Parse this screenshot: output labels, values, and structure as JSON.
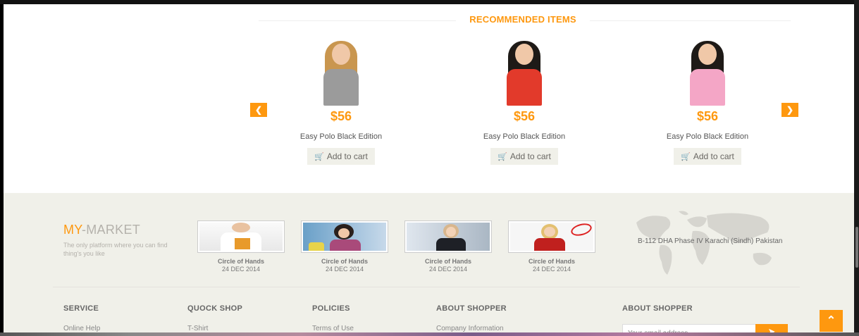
{
  "recommended": {
    "title": "RECOMMENDED ITEMS",
    "products": [
      {
        "price": "$56",
        "name": "Easy Polo Black Edition",
        "cart_label": "Add to cart",
        "cart_icon": "shopping-cart-icon",
        "hair_color": "#c9964f",
        "outfit_color": "#9b9b9b"
      },
      {
        "price": "$56",
        "name": "Easy Polo Black Edition",
        "cart_label": "Add to cart",
        "cart_icon": "shopping-cart-icon",
        "hair_color": "#1e1a17",
        "outfit_color": "#e23a2b"
      },
      {
        "price": "$56",
        "name": "Easy Polo Black Edition",
        "cart_label": "Add to cart",
        "cart_icon": "shopping-cart-icon",
        "hair_color": "#1e1a17",
        "outfit_color": "#f4a6c6"
      }
    ],
    "prev_icon": "chevron-left-icon",
    "next_icon": "chevron-right-icon"
  },
  "footer": {
    "brand_accent": "MY",
    "brand_rest": "-MARKET",
    "tagline": "The only platform where you can find thing's you like",
    "videos": [
      {
        "title": "Circle of Hands",
        "date": "24 DEC 2014"
      },
      {
        "title": "Circle of Hands",
        "date": "24 DEC 2014"
      },
      {
        "title": "Circle of Hands",
        "date": "24 DEC 2014"
      },
      {
        "title": "Circle of Hands",
        "date": "24 DEC 2014"
      }
    ],
    "address": "B-112 DHA Phase IV Karachi (Sindh) Pakistan",
    "columns": [
      {
        "heading": "SERVICE",
        "first_link": "Online Help"
      },
      {
        "heading": "QUOCK SHOP",
        "first_link": "T-Shirt"
      },
      {
        "heading": "POLICIES",
        "first_link": "Terms of Use"
      },
      {
        "heading": "ABOUT SHOPPER",
        "first_link": "Company Information"
      }
    ],
    "subscribe": {
      "heading": "ABOUT SHOPPER",
      "placeholder": "Your email address",
      "button_icon": "arrow-circle-right-icon"
    }
  },
  "scroll_up_icon": "chevron-up-icon",
  "colors": {
    "accent": "#FE980F",
    "footer_bg": "#F0F0E9"
  }
}
